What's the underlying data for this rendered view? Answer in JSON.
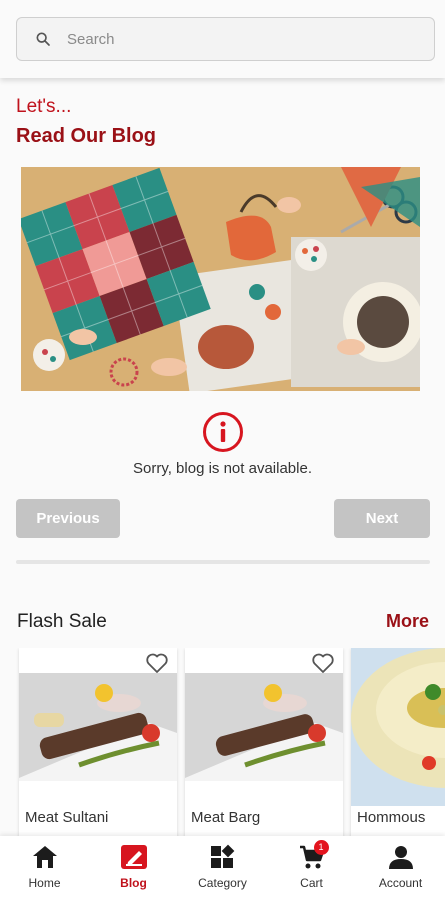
{
  "search": {
    "placeholder": "Search"
  },
  "blog": {
    "intro": "Let's...",
    "title": "Read Our Blog",
    "empty_message": "Sorry, blog is not available.",
    "prev_label": "Previous",
    "next_label": "Next"
  },
  "flash_sale": {
    "title": "Flash Sale",
    "more_label": "More",
    "products": [
      {
        "name": "Meat Sultani",
        "favorite": false
      },
      {
        "name": "Meat Barg",
        "favorite": false
      },
      {
        "name": "Hommous",
        "favorite": false
      }
    ]
  },
  "nav": {
    "items": [
      {
        "label": "Home",
        "icon": "home-icon",
        "active": false
      },
      {
        "label": "Blog",
        "icon": "blog-icon",
        "active": true
      },
      {
        "label": "Category",
        "icon": "category-icon",
        "active": false
      },
      {
        "label": "Cart",
        "icon": "cart-icon",
        "active": false,
        "badge": "1"
      },
      {
        "label": "Account",
        "icon": "account-icon",
        "active": false
      }
    ]
  },
  "colors": {
    "accent": "#c0121c",
    "title": "#9a1016",
    "disabled_button": "#c4c4c4",
    "badge": "#e3141e"
  }
}
